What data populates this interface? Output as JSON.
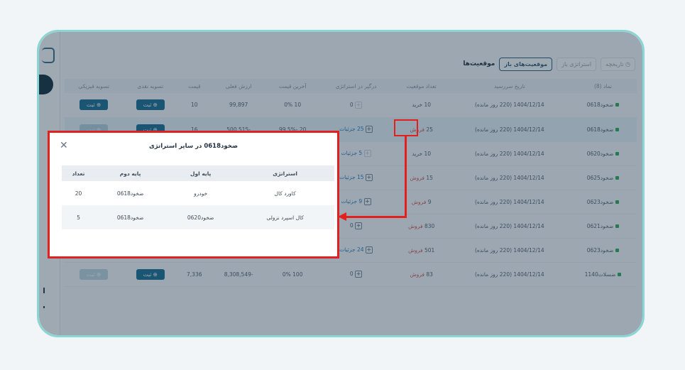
{
  "toolbar": {
    "title": "موقعیت‌ها",
    "tabs": [
      "موقعیت‌های باز",
      "استراتژی باز",
      "تاریخچه"
    ]
  },
  "table": {
    "columns": [
      "نماد (8)",
      "تاریخ سررسید",
      "تعداد موقعیت",
      "درگیر در استراتژی",
      "آخرین قیمت",
      "ارزش فعلی",
      "قیمت",
      "تسویه نقدی",
      "تسویه فیزیکی"
    ],
    "rows": [
      {
        "symbol": "ضخود0618",
        "due": "1404/12/14 (220 روز مانده)",
        "side": "خرید",
        "qty": "10",
        "strategy": "0",
        "last": "10 0%",
        "value": "99,897",
        "price": "10",
        "cash": "ثبت",
        "phys": "ثبت"
      },
      {
        "symbol": "ضخود0618",
        "due": "1404/12/14 (220 روز مانده)",
        "side": "فروش",
        "qty": "25",
        "strategy": "25 جزئیات",
        "last": "20 -99.5%",
        "value": "-500,515",
        "price": "16",
        "cash": "ثبت",
        "phys": "ثبت"
      },
      {
        "symbol": "ضخود0620",
        "due": "1404/12/14 (220 روز مانده)",
        "side": "خرید",
        "qty": "10",
        "strategy": "5 جزئیات",
        "last": "",
        "value": "",
        "price": "",
        "cash": "",
        "phys": ""
      },
      {
        "symbol": "ضخود0625",
        "due": "1404/12/14 (220 روز مانده)",
        "side": "فروش",
        "qty": "15",
        "strategy": "15 جزئیات",
        "last": "",
        "value": "",
        "price": "",
        "cash": "",
        "phys": ""
      },
      {
        "symbol": "ضخود0623",
        "due": "1404/12/14 (220 روز مانده)",
        "side": "فروش",
        "qty": "9",
        "strategy": "9 جزئیات",
        "last": "",
        "value": "",
        "price": "",
        "cash": "",
        "phys": ""
      },
      {
        "symbol": "ضخود0621",
        "due": "1404/12/14 (220 روز مانده)",
        "side": "فروش",
        "qty": "830",
        "strategy": "0",
        "last": "",
        "value": "",
        "price": "",
        "cash": "",
        "phys": ""
      },
      {
        "symbol": "ضخود0623",
        "due": "1404/12/14 (220 روز مانده)",
        "side": "فروش",
        "qty": "501",
        "strategy": "24 جزئیات",
        "last": "",
        "value": "",
        "price": "",
        "cash": "",
        "phys": ""
      },
      {
        "symbol": "ضسلات1140",
        "due": "1404/12/14 (220 روز مانده)",
        "side": "فروش",
        "qty": "83",
        "strategy": "0",
        "last": "100 0%",
        "value": "-8,308,549",
        "price": "7,336",
        "cash": "ثبت",
        "phys": "ثبت"
      }
    ]
  },
  "modal": {
    "title": "ضخود0618 در سایر استراتژی",
    "close_icon": "close-icon",
    "columns": [
      "استراتژی",
      "پایه اول",
      "پایه دوم",
      "تعداد"
    ],
    "rows": [
      {
        "strategy": "کاورد کال",
        "leg1": "خودرو",
        "leg2": "ضخود0618",
        "count": "20"
      },
      {
        "strategy": "کال اسپرد نزولی",
        "leg1": "ضخود0620",
        "leg2": "ضخود0618",
        "count": "5"
      }
    ]
  },
  "colors": {
    "accent": "#1a6f93",
    "highlight": "#e32020",
    "frame": "#8ad6d4"
  }
}
